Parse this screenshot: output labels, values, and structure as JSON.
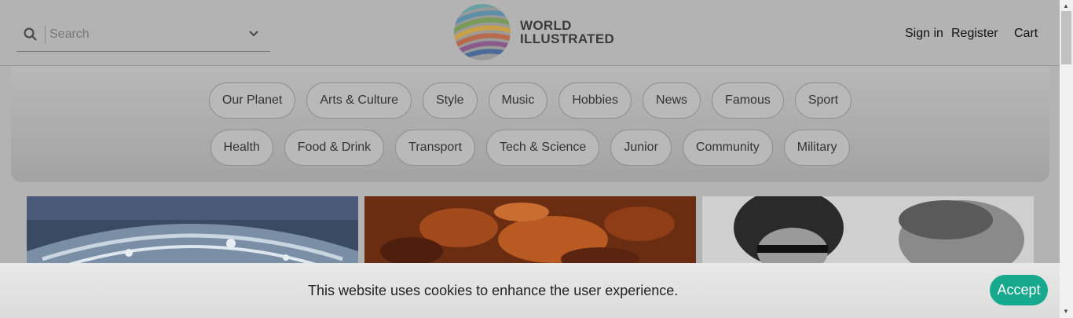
{
  "header": {
    "search": {
      "placeholder": "Search"
    },
    "logo": {
      "line1": "WORLD",
      "line2": "ILLUSTRATED"
    },
    "account": {
      "sign_in": "Sign in",
      "register": "Register",
      "cart": "Cart"
    }
  },
  "nav": {
    "row1": [
      "Our Planet",
      "Arts & Culture",
      "Style",
      "Music",
      "Hobbies",
      "News",
      "Famous",
      "Sport"
    ],
    "row2": [
      "Health",
      "Food & Drink",
      "Transport",
      "Tech & Science",
      "Junior",
      "Community",
      "Military"
    ]
  },
  "cookie_banner": {
    "message": "This website uses cookies to enhance the user experience.",
    "accept_label": "Accept"
  },
  "colors": {
    "accent": "#17a98e",
    "overlay": "#b3b3b3"
  }
}
